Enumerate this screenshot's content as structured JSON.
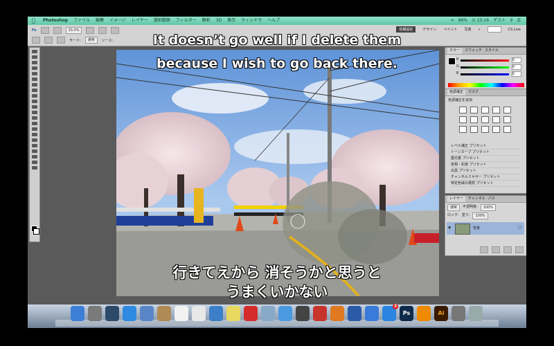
{
  "menubar": {
    "apple": "",
    "items": [
      "Photoshop",
      "ファイル",
      "編集",
      "イメージ",
      "レイヤー",
      "選択範囲",
      "フィルター",
      "解析",
      "3D",
      "表示",
      "ウィンドウ",
      "ヘルプ"
    ],
    "battery": "86%",
    "clock": "火 15:16",
    "user": "ゲスト"
  },
  "options": {
    "zoom": "33.3%",
    "mode_label": "モード:",
    "mode_value": "通常",
    "source_label": "ソース:",
    "workspaces": [
      "初期設定",
      "デザイン",
      "ペイント",
      "写真"
    ],
    "cs_live": "CS Live"
  },
  "color_panel": {
    "tabs": [
      "カラー",
      "スウォッチ",
      "スタイル"
    ],
    "r": "0",
    "g": "0",
    "b": "0"
  },
  "adjust_panel": {
    "tabs": [
      "色調補正",
      "マスク"
    ],
    "title": "色調補正を追加",
    "presets": [
      "レベル補正 プリセット",
      "トーンカーブ プリセット",
      "露光量 プリセット",
      "色相・彩度 プリセット",
      "白黒 プリセット",
      "チャンネルミキサー プリセット",
      "特定色域の選択 プリセット"
    ]
  },
  "layers_panel": {
    "tabs": [
      "レイヤー",
      "チャンネル",
      "パス"
    ],
    "blend": "通常",
    "opacity_label": "不透明度:",
    "opacity": "100%",
    "lock_label": "ロック:",
    "fill_label": "塗り:",
    "fill": "100%",
    "layer_name": "背景"
  },
  "caption": {
    "en_line1": "It doesn’t go well if I delete them",
    "en_line2": "because I wish to go back there.",
    "jp_line1": "行きてえから 消そうかと思うと",
    "jp_line2": "うまくいかない"
  },
  "dock": {
    "icons": [
      {
        "name": "finder-icon",
        "color": "#3d7fd6"
      },
      {
        "name": "launchpad-icon",
        "color": "#7a7a7a"
      },
      {
        "name": "mission-control-icon",
        "color": "#2e4a6b"
      },
      {
        "name": "safari-icon",
        "color": "#2d8ae0"
      },
      {
        "name": "photo-icon",
        "color": "#5a86c8"
      },
      {
        "name": "contacts-icon",
        "color": "#b08a55"
      },
      {
        "name": "calendar-icon",
        "color": "#f2f2f2"
      },
      {
        "name": "reminders-icon",
        "color": "#e8e8e8"
      },
      {
        "name": "preview-icon",
        "color": "#3c7ec8"
      },
      {
        "name": "stickies-icon",
        "color": "#e8d860"
      },
      {
        "name": "youtube-icon",
        "color": "#d42b2b"
      },
      {
        "name": "preview2-icon",
        "color": "#88a8c8"
      },
      {
        "name": "messages-icon",
        "color": "#4a9ae0"
      },
      {
        "name": "facetime-icon",
        "color": "#444"
      },
      {
        "name": "photo-booth-icon",
        "color": "#c8342c"
      },
      {
        "name": "ibooks-icon",
        "color": "#e07a20"
      },
      {
        "name": "word-icon",
        "color": "#2a5aa8"
      },
      {
        "name": "itunes-icon",
        "color": "#3a7ad8"
      },
      {
        "name": "app-store-icon",
        "color": "#2a84e0"
      },
      {
        "name": "photoshop-icon",
        "color": "#0f2a4a"
      },
      {
        "name": "vlc-icon",
        "color": "#f08a00"
      },
      {
        "name": "illustrator-icon",
        "color": "#3a1a00"
      },
      {
        "name": "system-preferences-icon",
        "color": "#777"
      },
      {
        "name": "trash-icon",
        "color": "#9aa"
      }
    ],
    "badge": "3",
    "ps_label": "Ps",
    "ai_label": "Ai"
  }
}
